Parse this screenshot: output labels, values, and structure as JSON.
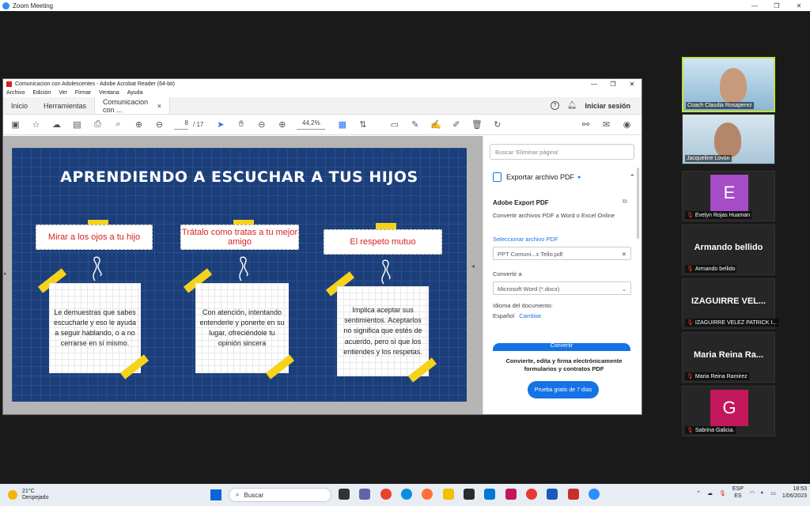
{
  "zoom": {
    "title": "Zoom Meeting",
    "window_buttons": [
      "—",
      "❐",
      "✕"
    ]
  },
  "acrobat": {
    "window_title": "Comunicacion con Adolescentes - Adobe Acrobat Reader (64-bit)",
    "menu": [
      "Archivo",
      "Edición",
      "Ver",
      "Firmar",
      "Ventana",
      "Ayuda"
    ],
    "tabs": {
      "home": "Inicio",
      "tools": "Herramientas",
      "doc": "Comunicacion con ...",
      "close": "×"
    },
    "help_icon": "?",
    "signin": "Iniciar sesión",
    "page_current": "8",
    "page_total": "/ 17",
    "zoom_level": "44,2%"
  },
  "slide": {
    "title": "APRENDIENDO A ESCUCHAR A TUS HIJOS",
    "cards": [
      {
        "label": "Mirar a los ojos a tu hijo",
        "text": "Le demuestras que sabes escucharle y eso le ayuda a seguir hablando, o a no cerrarse en sí mismo."
      },
      {
        "label": "Trátalo como tratas a tu mejor amigo",
        "text": "Con atención, intentando entenderle y ponerte en su lugar, ofreciéndole tu opinión sincera"
      },
      {
        "label": "El respeto mutuo",
        "text": "Implica aceptar sus sentimientos. Aceptarlos no significa que estés de acuerdo, pero sí que los entiendes y los respetas."
      }
    ]
  },
  "right_pane": {
    "search_placeholder": "Buscar 'Eliminar página'",
    "export_header": "Exportar archivo PDF",
    "section_title": "Adobe Export PDF",
    "description": "Convertir archivos PDF a Word o Excel Online",
    "select_file_label": "Seleccionar archivo PDF",
    "file_name": "PPT Comuni...x Tello.pdf",
    "convert_to_label": "Convertir a",
    "convert_format": "Microsoft Word (*.docx)",
    "doc_language_label": "Idioma del documento:",
    "doc_language": "Español",
    "change_link": "Cambiar",
    "convert_button": "Convertir",
    "promo": "Convierte, edita y firma electrónicamente formularios y contratos PDF",
    "trial_button": "Prueba gratis de 7 días"
  },
  "participants": [
    {
      "name": "Coach Claudia Rosaperez",
      "type": "video",
      "active": true
    },
    {
      "name": "Jacqueline Lovón",
      "type": "video",
      "active": false
    },
    {
      "name": "Evelyn Rojas Huaman",
      "type": "avatar",
      "initial": "E",
      "color": "#a64cc7"
    },
    {
      "name": "Armando bellido",
      "type": "name",
      "display": "Armando bellido"
    },
    {
      "name": "IZAGUIRRE VELEZ PATRICK I...",
      "type": "name",
      "display": "IZAGUIRRE  VEL..."
    },
    {
      "name": "Maria Reina Ramirez",
      "type": "name",
      "display": "Maria Reina Ra..."
    },
    {
      "name": "Sabrina Galicia.",
      "type": "avatar",
      "initial": "G",
      "color": "#c2185b"
    }
  ],
  "taskbar": {
    "temperature": "21°C",
    "weather": "Despejado",
    "search": "Buscar",
    "lang_top": "ESP",
    "lang_bottom": "ES",
    "time": "18:53",
    "date": "1/06/2023"
  },
  "colors": {
    "slide_bg": "#1c3f7a",
    "tape": "#f6d31b",
    "label_text": "#d92020",
    "accent_blue": "#1473e6",
    "active_speaker": "#c5e03a"
  }
}
